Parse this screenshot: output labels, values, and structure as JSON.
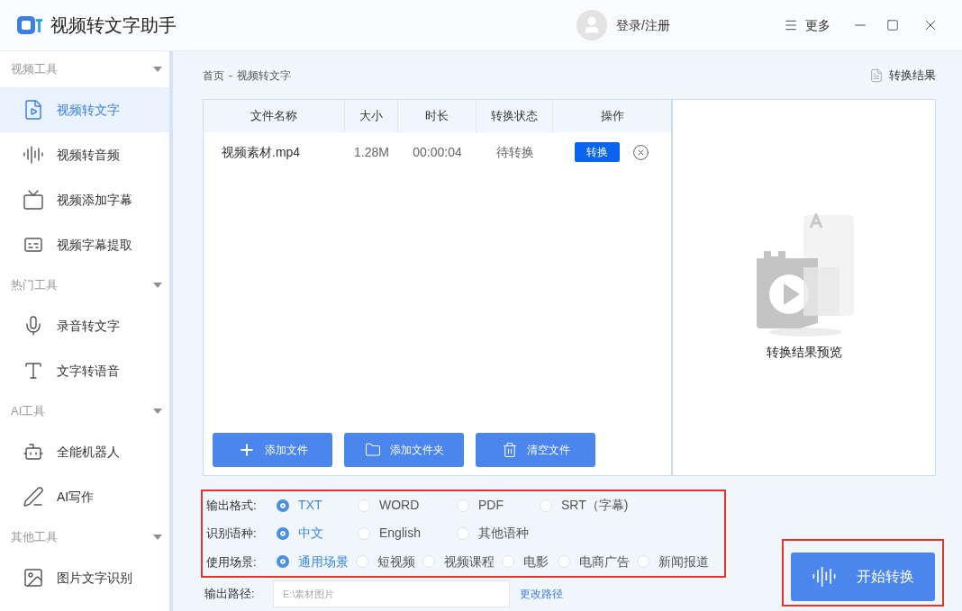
{
  "window": {
    "title": "视频转文字助手",
    "login": "登录/注册",
    "more": "更多"
  },
  "sidebar": [
    {
      "header": "视频工具",
      "items": [
        {
          "label": "视频转文字",
          "selected": true
        },
        {
          "label": "视频转音频",
          "selected": false
        },
        {
          "label": "视频添加字幕",
          "selected": false
        },
        {
          "label": "视频字幕提取",
          "selected": false
        }
      ]
    },
    {
      "header": "热门工具",
      "items": [
        {
          "label": "录音转文字",
          "selected": false
        },
        {
          "label": "文字转语音",
          "selected": false
        }
      ]
    },
    {
      "header": "AI工具",
      "items": [
        {
          "label": "全能机器人",
          "selected": false
        },
        {
          "label": "AI写作",
          "selected": false
        }
      ]
    },
    {
      "header": "其他工具",
      "items": [
        {
          "label": "图片文字识别",
          "selected": false
        }
      ]
    }
  ],
  "breadcrumb": [
    "首页",
    "-",
    "视频转文字"
  ],
  "result_link": "转换结果",
  "table": {
    "columns": [
      "文件名称",
      "大小",
      "时长",
      "转换状态",
      "操作"
    ],
    "rows": [
      {
        "name": "视频素材.mp4",
        "size": "1.28M",
        "duration": "00:00:04",
        "status": "待转换",
        "action": "转换"
      }
    ]
  },
  "file_buttons": [
    "添加文件",
    "添加文件夹",
    "清空文件"
  ],
  "preview": {
    "caption": "转换结果预览"
  },
  "options": [
    {
      "label": "输出格式:",
      "choices": [
        {
          "label": "TXT",
          "selected": true
        },
        {
          "label": "WORD",
          "selected": false
        },
        {
          "label": "PDF",
          "selected": false
        },
        {
          "label": "SRT（字幕)",
          "selected": false
        }
      ]
    },
    {
      "label": "识别语种:",
      "choices": [
        {
          "label": "中文",
          "selected": true
        },
        {
          "label": "English",
          "selected": false
        },
        {
          "label": "其他语种",
          "selected": false
        }
      ]
    },
    {
      "label": "使用场景:",
      "choices": [
        {
          "label": "通用场景",
          "selected": true
        },
        {
          "label": "短视频",
          "selected": false
        },
        {
          "label": "视频课程",
          "selected": false
        },
        {
          "label": "电影",
          "selected": false
        },
        {
          "label": "电商广告",
          "selected": false
        },
        {
          "label": "新闻报道",
          "selected": false
        }
      ]
    }
  ],
  "output_path": {
    "label": "输出路径:",
    "placeholder": "E:\\素材图片",
    "change": "更改路径"
  },
  "start_button": "开始转换"
}
